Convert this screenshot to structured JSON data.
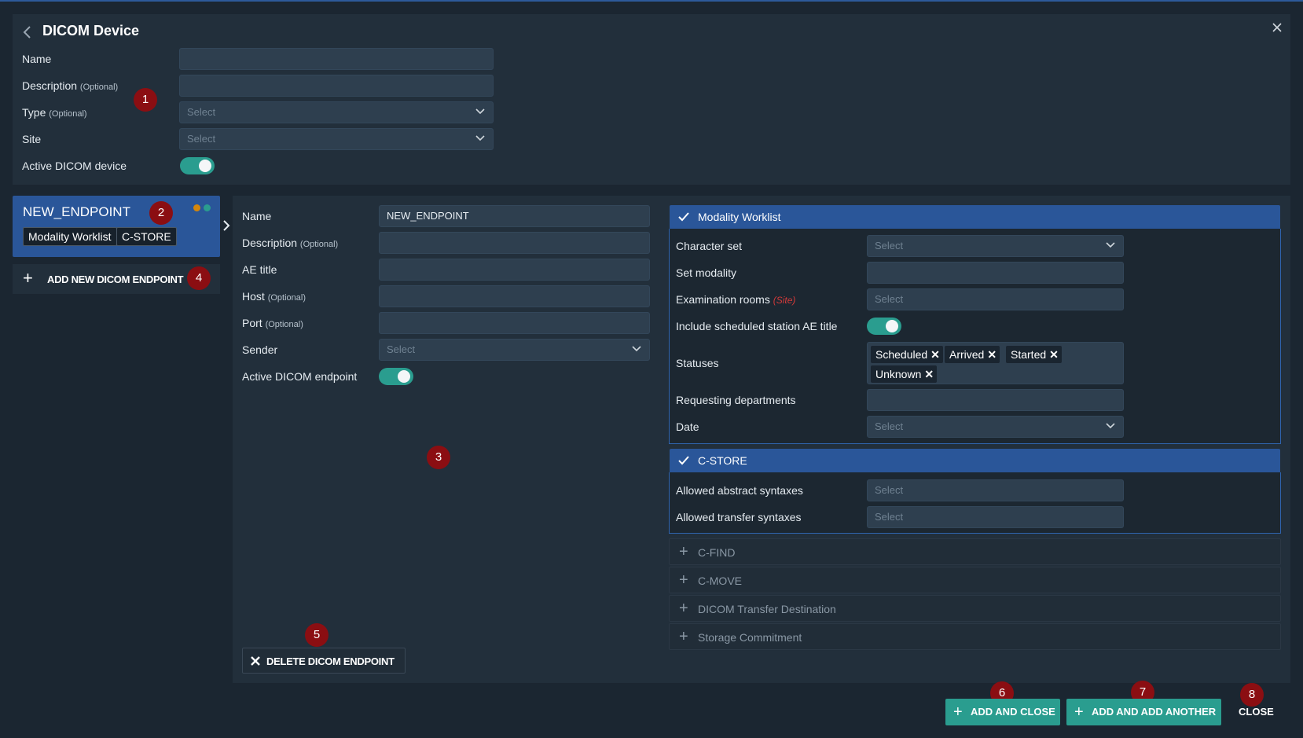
{
  "header": {
    "title": "DICOM Device"
  },
  "device": {
    "name_label": "Name",
    "description_label": "Description",
    "type_label": "Type",
    "site_label": "Site",
    "active_label": "Active DICOM device",
    "optional_tag": "(Optional)",
    "type_placeholder": "Select",
    "site_placeholder": "Select"
  },
  "endpoints": {
    "card_name": "NEW_ENDPOINT",
    "tags": [
      "Modality Worklist",
      "C-STORE"
    ],
    "add_label": "ADD NEW DICOM ENDPOINT"
  },
  "endpoint_form": {
    "name_label": "Name",
    "name_value": "NEW_ENDPOINT",
    "description_label": "Description",
    "ae_title_label": "AE title",
    "host_label": "Host",
    "port_label": "Port",
    "sender_label": "Sender",
    "sender_placeholder": "Select",
    "active_label": "Active DICOM endpoint",
    "delete_label": "DELETE DICOM ENDPOINT"
  },
  "modality_worklist": {
    "title": "Modality Worklist",
    "character_set_label": "Character set",
    "character_set_placeholder": "Select",
    "set_modality_label": "Set modality",
    "exam_rooms_label": "Examination rooms",
    "exam_rooms_note": "(Site)",
    "exam_rooms_placeholder": "Select",
    "include_ae_label": "Include scheduled station AE title",
    "statuses_label": "Statuses",
    "statuses": [
      "Scheduled",
      "Arrived",
      "Started",
      "Unknown"
    ],
    "requesting_label": "Requesting departments",
    "date_label": "Date",
    "date_placeholder": "Select"
  },
  "cstore": {
    "title": "C-STORE",
    "abstract_label": "Allowed abstract syntaxes",
    "abstract_placeholder": "Select",
    "transfer_label": "Allowed transfer syntaxes",
    "transfer_placeholder": "Select"
  },
  "collapsed_sections": [
    "C-FIND",
    "C-MOVE",
    "DICOM Transfer Destination",
    "Storage Commitment"
  ],
  "footer": {
    "add_close": "ADD AND CLOSE",
    "add_another": "ADD AND ADD ANOTHER",
    "close": "CLOSE"
  },
  "badges": [
    "1",
    "2",
    "3",
    "4",
    "5",
    "6",
    "7",
    "8"
  ],
  "colors": {
    "accent_blue": "#2a5699",
    "teal": "#2a9d8f",
    "badge_red": "#8b0e12",
    "status_orange": "#d4860b",
    "status_green": "#2a9d8f"
  }
}
